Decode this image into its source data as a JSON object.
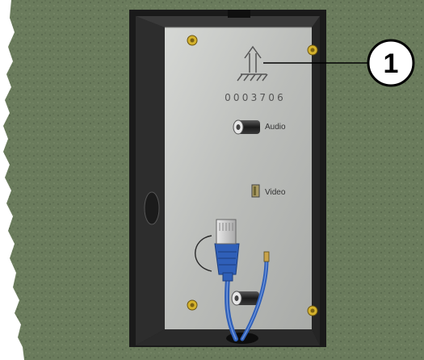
{
  "figure": {
    "callout_number": "1",
    "serial_number": "0003706",
    "labels": {
      "audio": "Audio",
      "video": "Video"
    },
    "icons": [
      "arrow-up-icon",
      "ground-hatch-icon"
    ],
    "colors": {
      "wall": "#6a7b5c",
      "wall_dark": "#4f5d45",
      "plate": "#bfc1bf",
      "box_frame": "#1f1f1f",
      "box_inner": "#2e2e2e",
      "screw": "#d4b22c",
      "cable": "#2f5fb8",
      "callout_fill": "#ffffff",
      "callout_stroke": "#000000"
    }
  }
}
